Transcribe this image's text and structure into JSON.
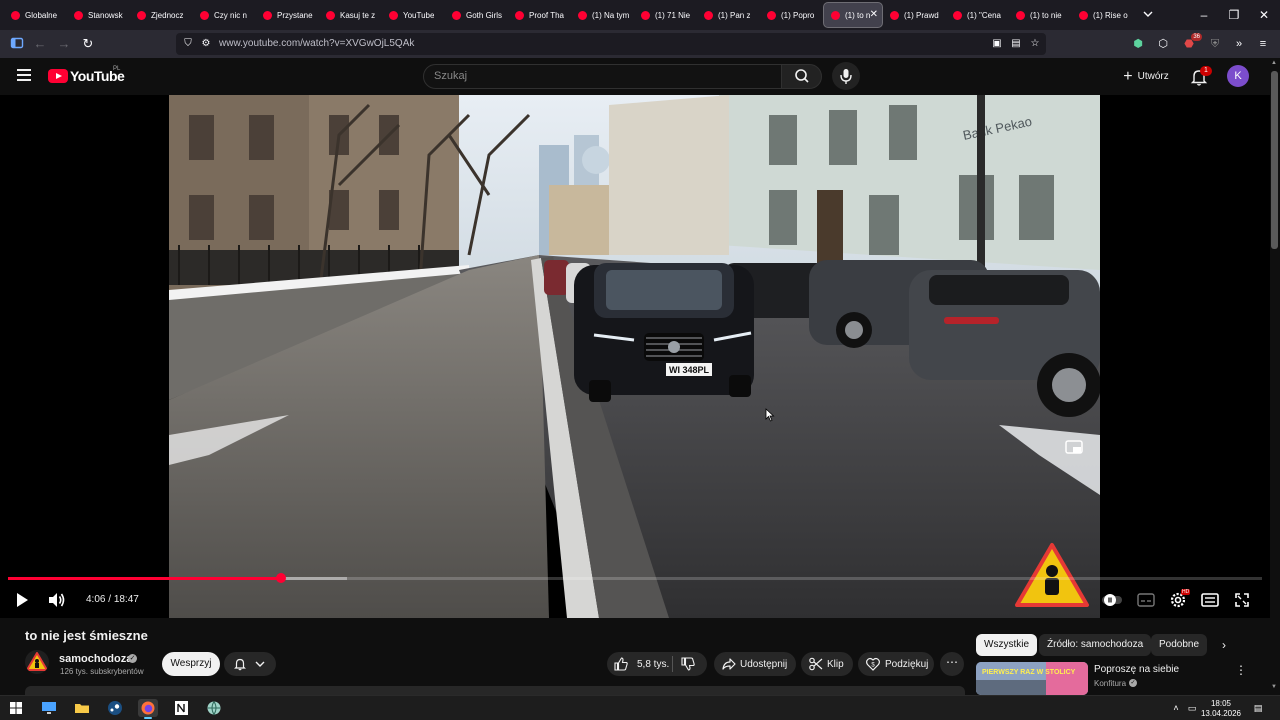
{
  "browser": {
    "tabs": [
      {
        "label": "Globalne"
      },
      {
        "label": "Stanowsk"
      },
      {
        "label": "Zjednocz"
      },
      {
        "label": "Czy nic n"
      },
      {
        "label": "Przystane"
      },
      {
        "label": "Kasuj te z"
      },
      {
        "label": "YouTube"
      },
      {
        "label": "Goth Girls"
      },
      {
        "label": "Proof Tha"
      },
      {
        "label": "(1) Na tym"
      },
      {
        "label": "(1) 71 Nie"
      },
      {
        "label": "(1) Pan z"
      },
      {
        "label": "(1) Popro"
      },
      {
        "label": "(1) to n",
        "active": true
      },
      {
        "label": "(1) Prawd"
      },
      {
        "label": "(1) \"Cena"
      },
      {
        "label": "(1) to nie"
      },
      {
        "label": "(1) Rise o"
      }
    ],
    "url": "www.youtube.com/watch?v=XVGwOjL5QAk",
    "extension_badge": "36"
  },
  "youtube": {
    "logo_text": "YouTube",
    "country_code": "PL",
    "search_placeholder": "Szukaj",
    "create_label": "Utwórz",
    "notification_count": "1",
    "avatar_letter": "K"
  },
  "player": {
    "current_time": "4:06",
    "duration": "18:47",
    "time_separator": " / ",
    "progress_fraction": 0.218,
    "buffered_fraction": 0.27,
    "settings_badge": "HD",
    "plate_text": "WI 348PL",
    "bank_sign": "Bank Pekao"
  },
  "video": {
    "title": "to nie jest śmieszne",
    "channel": "samochodoza",
    "subscribers": "126 tys. subskrybentów",
    "support_label": "Wesprzyj",
    "like_count": "5,8 tys.",
    "share_label": "Udostępnij",
    "clip_label": "Klip",
    "thanks_label": "Podziękuj"
  },
  "sidebar": {
    "chips": [
      {
        "label": "Wszystkie",
        "selected": true
      },
      {
        "label": "Źródło: samochodoza"
      },
      {
        "label": "Podobne"
      }
    ],
    "related": {
      "title": "Poproszę na siebie",
      "channel": "Konfitura",
      "thumb_text": "PIERWSZY RAZ W STOLICY"
    }
  },
  "taskbar": {
    "time": "18:05",
    "date": "13.04.2026"
  },
  "colors": {
    "yt_red": "#ff0033",
    "page_bg": "#0f0f0f",
    "avatar_purple": "#7c4dcc"
  }
}
